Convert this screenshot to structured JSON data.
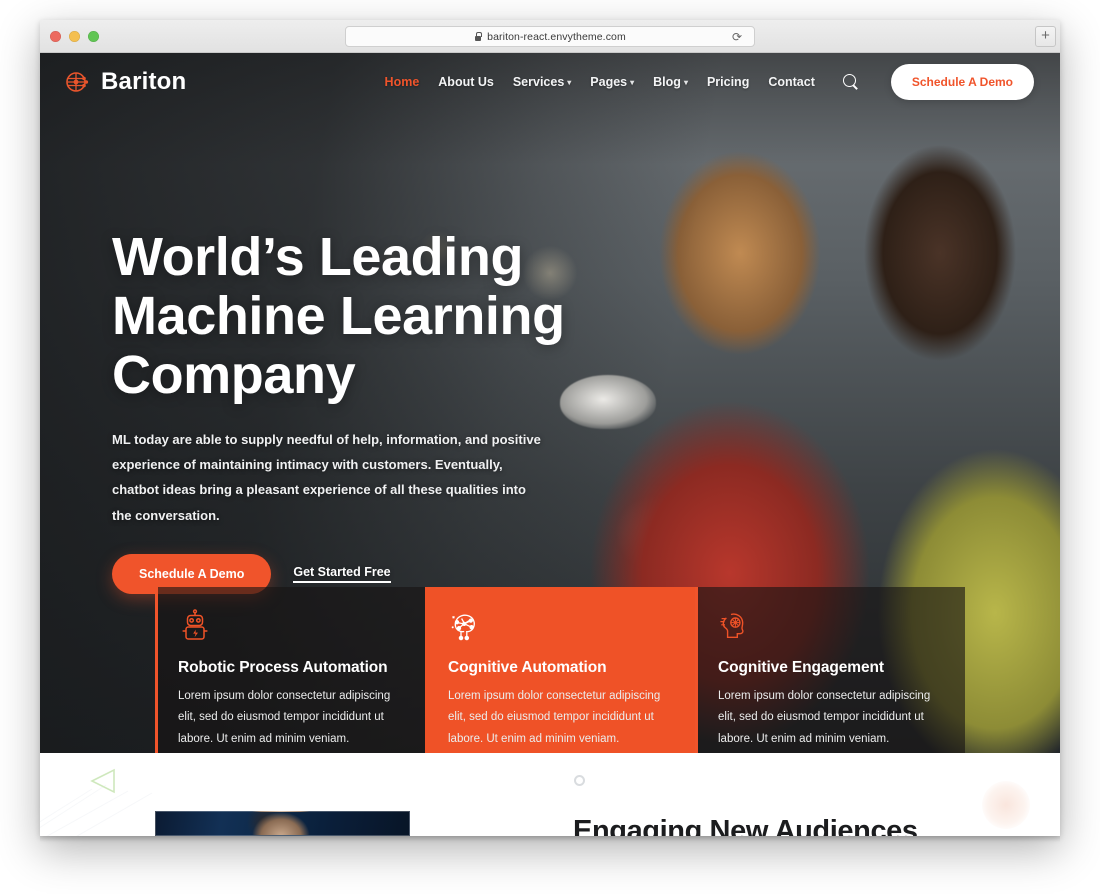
{
  "browser": {
    "url": "bariton-react.envytheme.com",
    "lock_icon": "lock-icon",
    "reload_icon": "reload-icon",
    "newtab_label": "+",
    "traffic_lights": [
      "close",
      "minimize",
      "maximize"
    ]
  },
  "site": {
    "logo_text": "Bariton",
    "logo_icon": "circuit-network-icon",
    "accent_color": "#f0542b",
    "card_active_color": "#ef5227"
  },
  "nav": {
    "items": [
      {
        "label": "Home",
        "active": true,
        "has_caret": false
      },
      {
        "label": "About Us",
        "active": false,
        "has_caret": false
      },
      {
        "label": "Services",
        "active": false,
        "has_caret": true
      },
      {
        "label": "Pages",
        "active": false,
        "has_caret": true
      },
      {
        "label": "Blog",
        "active": false,
        "has_caret": true
      },
      {
        "label": "Pricing",
        "active": false,
        "has_caret": false
      },
      {
        "label": "Contact",
        "active": false,
        "has_caret": false
      }
    ],
    "search_icon": "search-icon",
    "cta_label": "Schedule A Demo"
  },
  "hero": {
    "title": "World’s Leading Machine Learning Company",
    "description": "ML today are able to supply needful of help, information, and positive experience of maintaining intimacy with customers. Eventually, chatbot ideas bring a pleasant experience of all these qualities into the conversation.",
    "primary_button": "Schedule A Demo",
    "secondary_link": "Get Started Free"
  },
  "features": [
    {
      "icon": "robot-icon",
      "title": "Robotic Process Automation",
      "description": "Lorem ipsum dolor consectetur adipiscing elit, sed do eiusmod tempor incididunt ut labore. Ut enim ad minim veniam.",
      "active": false
    },
    {
      "icon": "neural-network-icon",
      "title": "Cognitive Automation",
      "description": "Lorem ipsum dolor consectetur adipiscing elit, sed do eiusmod tempor incididunt ut labore. Ut enim ad minim veniam.",
      "active": true
    },
    {
      "icon": "head-brain-icon",
      "title": "Cognitive Engagement",
      "description": "Lorem ipsum dolor consectetur adipiscing elit, sed do eiusmod tempor incididunt ut labore. Ut enim ad minim veniam.",
      "active": false
    }
  ],
  "next_section": {
    "heading": "Engaging New Audiences",
    "carousel_dot": "carousel-indicator",
    "deco_triangle": "triangle-outline-decoration",
    "deco_blob": "circle-blob-decoration",
    "thumbnail": "video-thumbnail"
  }
}
